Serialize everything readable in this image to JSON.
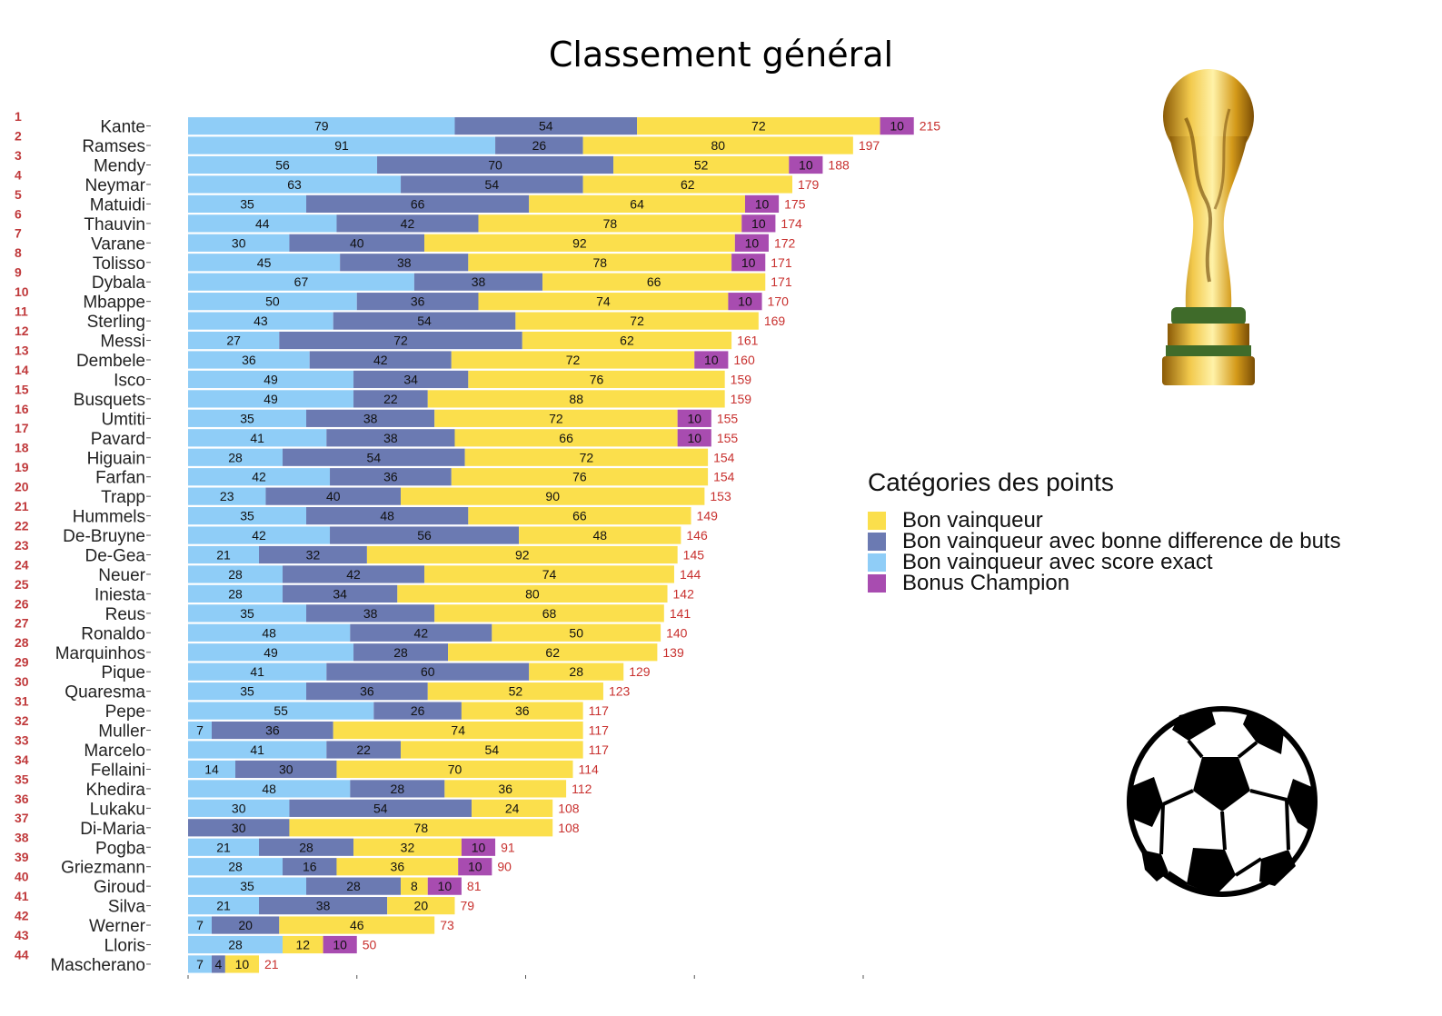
{
  "title": "Classement général",
  "colors": {
    "score_exact": "#8fcdf7",
    "difference": "#6b7ab2",
    "vainqueur": "#fbdf4c",
    "bonus": "#a84cb0",
    "total": "#c8302e",
    "rank": "#c0393b"
  },
  "legend": {
    "title": "Catégories des points",
    "items": [
      {
        "label": "Bon vainqueur",
        "color": "#fbdf4c"
      },
      {
        "label": "Bon vainqueur avec bonne difference de buts",
        "color": "#6b7ab2"
      },
      {
        "label": "Bon vainqueur avec score exact",
        "color": "#8fcdf7"
      },
      {
        "label": "Bonus Champion",
        "color": "#a84cb0"
      }
    ]
  },
  "images": {
    "trophy": "world-cup-trophy-icon",
    "ball": "soccer-ball-icon"
  },
  "chart_data": {
    "type": "bar",
    "orientation": "horizontal",
    "stacked": true,
    "xlim": [
      0,
      240
    ],
    "ranks": [
      1,
      2,
      3,
      4,
      5,
      6,
      7,
      8,
      9,
      10,
      11,
      12,
      13,
      14,
      15,
      16,
      17,
      18,
      19,
      20,
      21,
      22,
      23,
      24,
      25,
      26,
      27,
      28,
      29,
      30,
      31,
      32,
      33,
      34,
      35,
      36,
      37,
      38,
      39,
      40,
      41,
      42,
      43,
      44
    ],
    "categories": [
      "Kante",
      "Ramses",
      "Mendy",
      "Neymar",
      "Matuidi",
      "Thauvin",
      "Varane",
      "Tolisso",
      "Dybala",
      "Mbappe",
      "Sterling",
      "Messi",
      "Dembele",
      "Isco",
      "Busquets",
      "Umtiti",
      "Pavard",
      "Higuain",
      "Farfan",
      "Trapp",
      "Hummels",
      "De-Bruyne",
      "De-Gea",
      "Neuer",
      "Iniesta",
      "Reus",
      "Ronaldo",
      "Marquinhos",
      "Pique",
      "Quaresma",
      "Pepe",
      "Muller",
      "Marcelo",
      "Fellaini",
      "Khedira",
      "Lukaku",
      "Di-Maria",
      "Pogba",
      "Griezmann",
      "Giroud",
      "Silva",
      "Werner",
      "Lloris",
      "Mascherano"
    ],
    "series": [
      {
        "name": "Bon vainqueur avec score exact",
        "values": [
          79,
          91,
          56,
          63,
          35,
          44,
          30,
          45,
          67,
          50,
          43,
          27,
          36,
          49,
          49,
          35,
          41,
          28,
          42,
          23,
          35,
          42,
          21,
          28,
          28,
          35,
          48,
          49,
          41,
          35,
          55,
          7,
          41,
          14,
          48,
          30,
          0,
          21,
          28,
          35,
          21,
          7,
          28,
          7
        ]
      },
      {
        "name": "Bon vainqueur avec bonne difference de buts",
        "values": [
          54,
          26,
          70,
          54,
          66,
          42,
          40,
          38,
          38,
          36,
          54,
          72,
          42,
          34,
          22,
          38,
          38,
          54,
          36,
          40,
          48,
          56,
          32,
          42,
          34,
          38,
          42,
          28,
          60,
          36,
          26,
          36,
          22,
          30,
          28,
          54,
          30,
          28,
          16,
          28,
          38,
          20,
          0,
          4
        ]
      },
      {
        "name": "Bon vainqueur",
        "values": [
          72,
          80,
          52,
          62,
          64,
          78,
          92,
          78,
          66,
          74,
          72,
          62,
          72,
          76,
          88,
          72,
          66,
          72,
          76,
          90,
          66,
          48,
          92,
          74,
          80,
          68,
          50,
          62,
          28,
          52,
          36,
          74,
          54,
          70,
          36,
          24,
          78,
          32,
          36,
          8,
          20,
          46,
          12,
          10
        ]
      },
      {
        "name": "Bonus Champion",
        "values": [
          10,
          0,
          10,
          0,
          10,
          10,
          10,
          10,
          0,
          10,
          0,
          0,
          10,
          0,
          0,
          10,
          10,
          0,
          0,
          0,
          0,
          0,
          0,
          0,
          0,
          0,
          0,
          0,
          0,
          0,
          0,
          0,
          0,
          0,
          0,
          0,
          0,
          10,
          10,
          10,
          0,
          0,
          10,
          0
        ]
      }
    ],
    "totals": [
      215,
      197,
      188,
      179,
      175,
      174,
      172,
      171,
      171,
      170,
      169,
      161,
      160,
      159,
      159,
      155,
      155,
      154,
      154,
      153,
      149,
      146,
      145,
      144,
      142,
      141,
      140,
      139,
      129,
      123,
      117,
      117,
      117,
      114,
      112,
      108,
      108,
      91,
      90,
      81,
      79,
      73,
      50,
      21
    ]
  }
}
